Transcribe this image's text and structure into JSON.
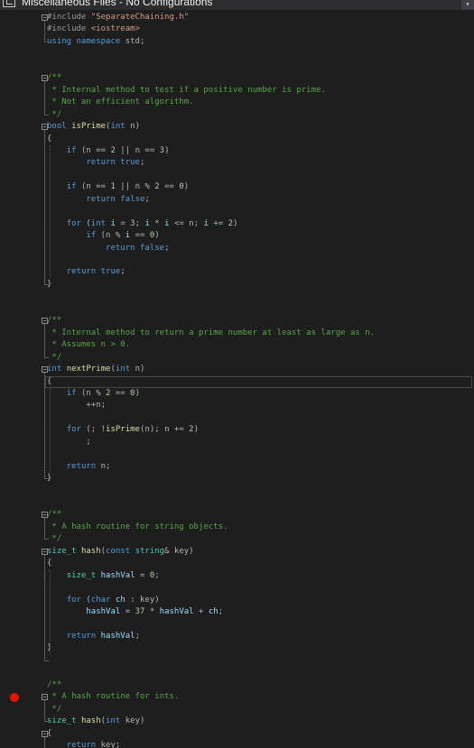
{
  "window": {
    "title": "Miscellaneous Files - No Configurations",
    "dropdown_glyph": "▾"
  },
  "editor": {
    "breakpoint_line": "size_t hash(int key)",
    "lines": [
      [
        [
          "p",
          "#include "
        ],
        [
          "s",
          "\"SeparateChaining.h\""
        ]
      ],
      [
        [
          "p",
          "#include "
        ],
        [
          "s",
          "<iostream>"
        ]
      ],
      [
        [
          "k",
          "using"
        ],
        [
          "o",
          " "
        ],
        [
          "k",
          "namespace"
        ],
        [
          "o",
          " std;"
        ]
      ],
      [],
      [],
      [
        [
          "c",
          "/**"
        ]
      ],
      [
        [
          "c",
          " * Internal method to test if a positive number is prime."
        ]
      ],
      [
        [
          "c",
          " * Not an efficient algorithm."
        ]
      ],
      [
        [
          "c",
          " */"
        ]
      ],
      [
        [
          "k",
          "bool"
        ],
        [
          "o",
          " "
        ],
        [
          "f",
          "isPrime"
        ],
        [
          "o",
          "("
        ],
        [
          "k",
          "int"
        ],
        [
          "o",
          " n)"
        ]
      ],
      [
        [
          "o",
          "{"
        ]
      ],
      [
        [
          "o",
          "    "
        ],
        [
          "k",
          "if"
        ],
        [
          "o",
          " (n == "
        ],
        [
          "n",
          "2"
        ],
        [
          "o",
          " || n == "
        ],
        [
          "n",
          "3"
        ],
        [
          "o",
          ")"
        ]
      ],
      [
        [
          "o",
          "        "
        ],
        [
          "k",
          "return"
        ],
        [
          "o",
          " "
        ],
        [
          "k",
          "true"
        ],
        [
          "o",
          ";"
        ]
      ],
      [],
      [
        [
          "o",
          "    "
        ],
        [
          "k",
          "if"
        ],
        [
          "o",
          " (n == "
        ],
        [
          "n",
          "1"
        ],
        [
          "o",
          " || n % "
        ],
        [
          "n",
          "2"
        ],
        [
          "o",
          " == "
        ],
        [
          "n",
          "0"
        ],
        [
          "o",
          ")"
        ]
      ],
      [
        [
          "o",
          "        "
        ],
        [
          "k",
          "return"
        ],
        [
          "o",
          " "
        ],
        [
          "k",
          "false"
        ],
        [
          "o",
          ";"
        ]
      ],
      [],
      [
        [
          "o",
          "    "
        ],
        [
          "k",
          "for"
        ],
        [
          "o",
          " ("
        ],
        [
          "k",
          "int"
        ],
        [
          "o",
          " "
        ],
        [
          "v",
          "i"
        ],
        [
          "o",
          " = "
        ],
        [
          "n",
          "3"
        ],
        [
          "o",
          "; "
        ],
        [
          "v",
          "i"
        ],
        [
          "o",
          " * "
        ],
        [
          "v",
          "i"
        ],
        [
          "o",
          " <= n; "
        ],
        [
          "v",
          "i"
        ],
        [
          "o",
          " += "
        ],
        [
          "n",
          "2"
        ],
        [
          "o",
          ")"
        ]
      ],
      [
        [
          "o",
          "        "
        ],
        [
          "k",
          "if"
        ],
        [
          "o",
          " (n % "
        ],
        [
          "v",
          "i"
        ],
        [
          "o",
          " == "
        ],
        [
          "n",
          "0"
        ],
        [
          "o",
          ")"
        ]
      ],
      [
        [
          "o",
          "            "
        ],
        [
          "k",
          "return"
        ],
        [
          "o",
          " "
        ],
        [
          "k",
          "false"
        ],
        [
          "o",
          ";"
        ]
      ],
      [],
      [
        [
          "o",
          "    "
        ],
        [
          "k",
          "return"
        ],
        [
          "o",
          " "
        ],
        [
          "k",
          "true"
        ],
        [
          "o",
          ";"
        ]
      ],
      [
        [
          "o",
          "}"
        ]
      ],
      [],
      [],
      [
        [
          "c",
          "/**"
        ]
      ],
      [
        [
          "c",
          " * Internal method to return a prime number at least as large as n."
        ]
      ],
      [
        [
          "c",
          " * Assumes n > 0."
        ]
      ],
      [
        [
          "c",
          " */"
        ]
      ],
      [
        [
          "k",
          "int"
        ],
        [
          "o",
          " "
        ],
        [
          "f",
          "nextPrime"
        ],
        [
          "o",
          "("
        ],
        [
          "k",
          "int"
        ],
        [
          "o",
          " n)"
        ]
      ],
      [
        [
          "o",
          "{"
        ]
      ],
      [
        [
          "o",
          "    "
        ],
        [
          "k",
          "if"
        ],
        [
          "o",
          " (n % "
        ],
        [
          "n",
          "2"
        ],
        [
          "o",
          " == "
        ],
        [
          "n",
          "0"
        ],
        [
          "o",
          ")"
        ]
      ],
      [
        [
          "o",
          "        ++n;"
        ]
      ],
      [],
      [
        [
          "o",
          "    "
        ],
        [
          "k",
          "for"
        ],
        [
          "o",
          " (; !"
        ],
        [
          "f",
          "isPrime"
        ],
        [
          "o",
          "(n); n += "
        ],
        [
          "n",
          "2"
        ],
        [
          "o",
          ")"
        ]
      ],
      [
        [
          "o",
          "        ;"
        ]
      ],
      [],
      [
        [
          "o",
          "    "
        ],
        [
          "k",
          "return"
        ],
        [
          "o",
          " n;"
        ]
      ],
      [
        [
          "o",
          "}"
        ]
      ],
      [],
      [],
      [
        [
          "c",
          "/**"
        ]
      ],
      [
        [
          "c",
          " * A hash routine for string objects."
        ]
      ],
      [
        [
          "c",
          " */"
        ]
      ],
      [
        [
          "t",
          "size_t"
        ],
        [
          "o",
          " "
        ],
        [
          "f",
          "hash"
        ],
        [
          "o",
          "("
        ],
        [
          "k",
          "const"
        ],
        [
          "o",
          " "
        ],
        [
          "t",
          "string"
        ],
        [
          "o",
          "& key)"
        ]
      ],
      [
        [
          "o",
          "{"
        ]
      ],
      [
        [
          "o",
          "    "
        ],
        [
          "t",
          "size_t"
        ],
        [
          "o",
          " "
        ],
        [
          "v",
          "hashVal"
        ],
        [
          "o",
          " = "
        ],
        [
          "n",
          "0"
        ],
        [
          "o",
          ";"
        ]
      ],
      [],
      [
        [
          "o",
          "    "
        ],
        [
          "k",
          "for"
        ],
        [
          "o",
          " ("
        ],
        [
          "k",
          "char"
        ],
        [
          "o",
          " "
        ],
        [
          "v",
          "ch"
        ],
        [
          "o",
          " : key)"
        ]
      ],
      [
        [
          "o",
          "        "
        ],
        [
          "v",
          "hashVal"
        ],
        [
          "o",
          " = "
        ],
        [
          "n",
          "37"
        ],
        [
          "o",
          " * "
        ],
        [
          "v",
          "hashVal"
        ],
        [
          "o",
          " + "
        ],
        [
          "v",
          "ch"
        ],
        [
          "o",
          ";"
        ]
      ],
      [],
      [
        [
          "o",
          "    "
        ],
        [
          "k",
          "return"
        ],
        [
          "o",
          " "
        ],
        [
          "v",
          "hashVal"
        ],
        [
          "o",
          ";"
        ]
      ],
      [
        [
          "o",
          "}"
        ]
      ],
      [],
      [],
      [
        [
          "c",
          "/**"
        ]
      ],
      [
        [
          "c",
          " * A hash routine for ints."
        ]
      ],
      [
        [
          "c",
          " */"
        ]
      ],
      [
        [
          "t",
          "size_t"
        ],
        [
          "o",
          " "
        ],
        [
          "f",
          "hash"
        ],
        [
          "o",
          "("
        ],
        [
          "k",
          "int"
        ],
        [
          "o",
          " key)"
        ]
      ],
      [
        [
          "o",
          "{"
        ]
      ],
      [
        [
          "o",
          "    "
        ],
        [
          "k",
          "return"
        ],
        [
          "o",
          " key;"
        ]
      ],
      [
        [
          "o",
          "}"
        ]
      ]
    ]
  }
}
